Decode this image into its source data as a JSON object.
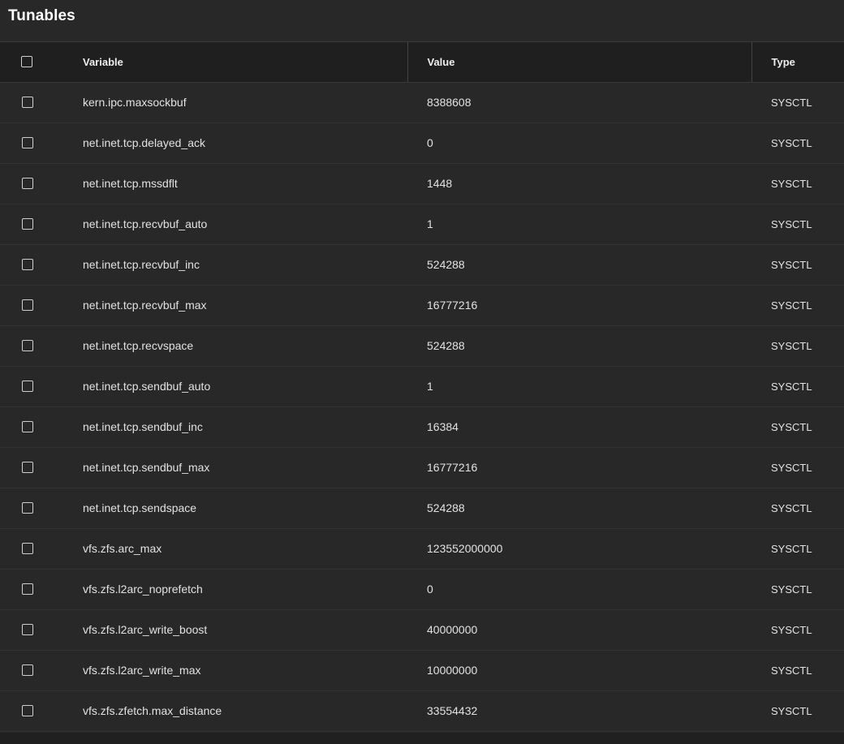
{
  "header": {
    "title": "Tunables"
  },
  "table": {
    "columns": {
      "variable": "Variable",
      "value": "Value",
      "type": "Type"
    },
    "rows": [
      {
        "variable": "kern.ipc.maxsockbuf",
        "value": "8388608",
        "type": "SYSCTL"
      },
      {
        "variable": "net.inet.tcp.delayed_ack",
        "value": "0",
        "type": "SYSCTL"
      },
      {
        "variable": "net.inet.tcp.mssdflt",
        "value": "1448",
        "type": "SYSCTL"
      },
      {
        "variable": "net.inet.tcp.recvbuf_auto",
        "value": "1",
        "type": "SYSCTL"
      },
      {
        "variable": "net.inet.tcp.recvbuf_inc",
        "value": "524288",
        "type": "SYSCTL"
      },
      {
        "variable": "net.inet.tcp.recvbuf_max",
        "value": "16777216",
        "type": "SYSCTL"
      },
      {
        "variable": "net.inet.tcp.recvspace",
        "value": "524288",
        "type": "SYSCTL"
      },
      {
        "variable": "net.inet.tcp.sendbuf_auto",
        "value": "1",
        "type": "SYSCTL"
      },
      {
        "variable": "net.inet.tcp.sendbuf_inc",
        "value": "16384",
        "type": "SYSCTL"
      },
      {
        "variable": "net.inet.tcp.sendbuf_max",
        "value": "16777216",
        "type": "SYSCTL"
      },
      {
        "variable": "net.inet.tcp.sendspace",
        "value": "524288",
        "type": "SYSCTL"
      },
      {
        "variable": "vfs.zfs.arc_max",
        "value": "123552000000",
        "type": "SYSCTL"
      },
      {
        "variable": "vfs.zfs.l2arc_noprefetch",
        "value": "0",
        "type": "SYSCTL"
      },
      {
        "variable": "vfs.zfs.l2arc_write_boost",
        "value": "40000000",
        "type": "SYSCTL"
      },
      {
        "variable": "vfs.zfs.l2arc_write_max",
        "value": "10000000",
        "type": "SYSCTL"
      },
      {
        "variable": "vfs.zfs.zfetch.max_distance",
        "value": "33554432",
        "type": "SYSCTL"
      }
    ]
  }
}
